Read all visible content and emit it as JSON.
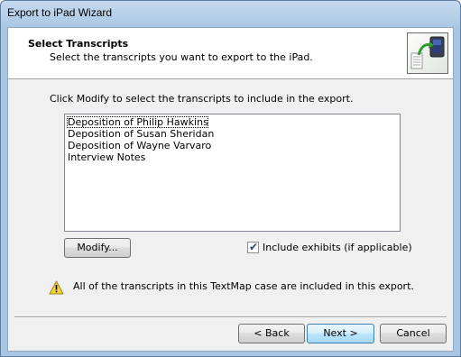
{
  "window": {
    "title": "Export to iPad Wizard"
  },
  "header": {
    "title": "Select Transcripts",
    "subtitle": "Select the transcripts you want to export to the iPad.",
    "icon": "ipad-export-icon"
  },
  "instruction": "Click Modify to select the transcripts to include in the export.",
  "transcripts": [
    "Deposition of Philip Hawkins",
    "Deposition of Susan Sheridan",
    "Deposition of Wayne Varvaro",
    "Interview Notes"
  ],
  "modify_label": "Modify...",
  "include_exhibits": {
    "label": "Include exhibits (if applicable)",
    "checked": true
  },
  "notice": {
    "icon": "warning-icon",
    "text": "All of the transcripts in this TextMap case are included in this export."
  },
  "buttons": {
    "back": "< Back",
    "next": "Next >",
    "cancel": "Cancel"
  },
  "colors": {
    "frame": "#a9c5e2",
    "client": "#f0f0f0",
    "default_button_border": "#3c7fb1"
  }
}
